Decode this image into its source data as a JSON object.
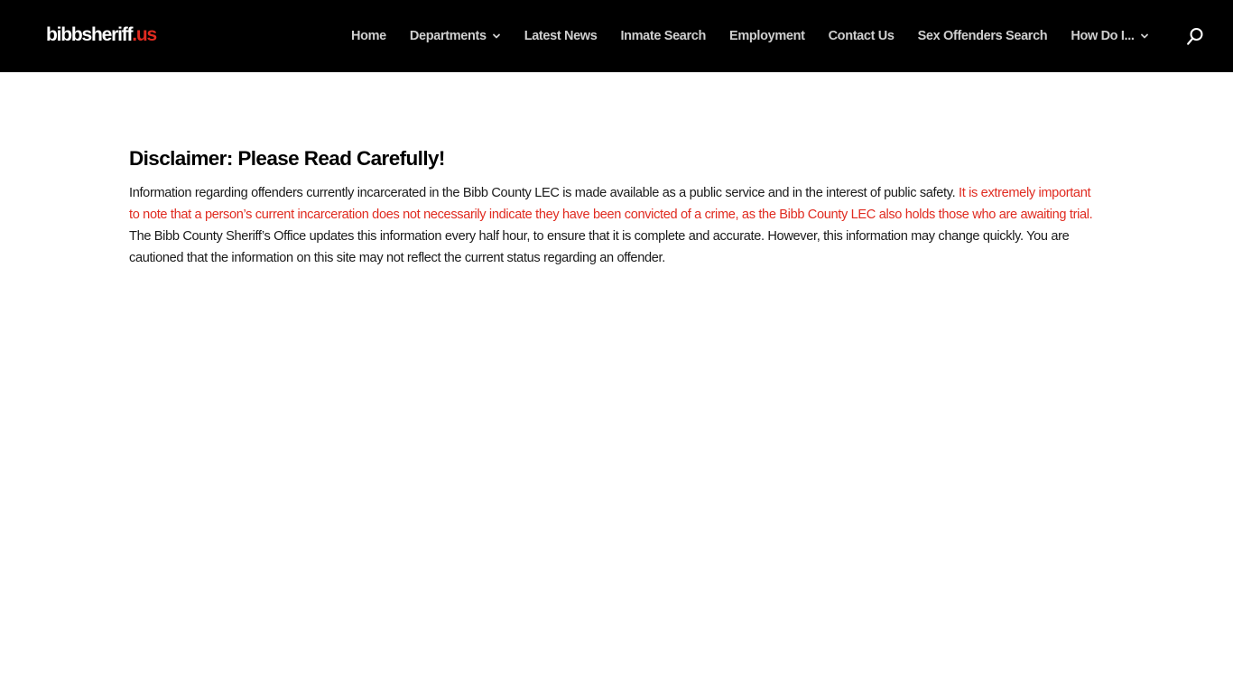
{
  "header": {
    "logo": {
      "main": "bibbsheriff",
      "accent": ".us"
    },
    "nav": [
      {
        "label": "Home"
      },
      {
        "label": "Departments",
        "has_dropdown": true
      },
      {
        "label": "Latest News"
      },
      {
        "label": "Inmate Search"
      },
      {
        "label": "Employment"
      },
      {
        "label": "Contact Us"
      },
      {
        "label": "Sex Offenders Search"
      },
      {
        "label": "How Do I...",
        "has_dropdown": true
      }
    ],
    "search_icon": "search-icon"
  },
  "main": {
    "title": "Disclaimer: Please Read Carefully!",
    "paragraph": {
      "part1": "Information regarding offenders currently incarcerated in the Bibb County LEC is made available as a public service and in the interest of public safety. ",
      "warning": "It is extremely important to note that a person’s current incarceration does not necessarily indicate they have been convicted of a crime, as the Bibb County LEC also holds those who are awaiting trial.",
      "part2": " The Bibb County Sheriff’s Office updates this information every half hour, to ensure that it is complete and accurate. However, this information may change quickly. You are cautioned that the information on this site may not reflect the current status regarding an offender."
    }
  },
  "colors": {
    "header_bg": "#000000",
    "accent_red": "#e02b20",
    "nav_text": "#cfcfcf",
    "body_text": "#1a1a1a"
  }
}
